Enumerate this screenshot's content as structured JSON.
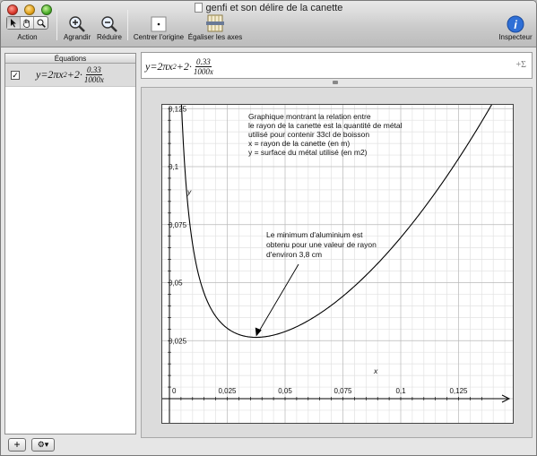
{
  "window": {
    "title": "genfi et son délire de la canette"
  },
  "toolbar": {
    "action_label": "Action",
    "zoom_in_label": "Agrandir",
    "zoom_out_label": "Réduire",
    "center_origin_label": "Centrer l'origine",
    "equalize_axes_label": "Égaliser les axes",
    "inspector_label": "Inspecteur"
  },
  "sidebar": {
    "header": "Équations",
    "equations": [
      {
        "checked": true,
        "lhs": "y=2πx",
        "exp": "2",
        "mid": "+2·",
        "num": "0.33",
        "den": "1000x"
      }
    ],
    "add_label": "+",
    "gear_label": "⚙▾"
  },
  "formula_bar": {
    "lhs": "y=2πx",
    "exp": "2",
    "mid": "+2·",
    "num": "0.33",
    "den": "1000x",
    "sigma": "+Σ"
  },
  "graph": {
    "x_label": "x",
    "y_label": "y",
    "x_ticks": [
      "0",
      "0,025",
      "0,05",
      "0,075",
      "0,1",
      "0,125"
    ],
    "y_ticks": [
      "0,025",
      "0,05",
      "0,075",
      "0,1",
      "0,125"
    ],
    "annotation_lines": [
      "Graphique montrant la relation entre",
      "le rayon de la canette est la quantité de métal",
      "utilisé pour contenir 33cl de boisson",
      "x = rayon de la canette (en m)",
      "y = surface du métal utilisé (en m2)"
    ],
    "minimum_lines": [
      "Le minimum d'aluminium est",
      "obtenu pour une valeur de rayon",
      "d'environ 3,8 cm"
    ]
  },
  "chart_data": {
    "type": "line",
    "title": "",
    "xlabel": "x",
    "ylabel": "y",
    "xlim": [
      0,
      0.14
    ],
    "ylim": [
      0,
      0.125
    ],
    "x_ticks": [
      0,
      0.025,
      0.05,
      0.075,
      0.1,
      0.125
    ],
    "y_ticks": [
      0.025,
      0.05,
      0.075,
      0.1,
      0.125
    ],
    "grid": true,
    "series": [
      {
        "expression": "y = 2πx² + 2·0.33/(1000x)",
        "x": [
          0.005,
          0.006,
          0.0075,
          0.01,
          0.0125,
          0.015,
          0.02,
          0.025,
          0.03,
          0.035,
          0.0375,
          0.04,
          0.045,
          0.05,
          0.06,
          0.07,
          0.08,
          0.09,
          0.1,
          0.11,
          0.12,
          0.13,
          0.14
        ],
        "y": [
          0.1322,
          0.1102,
          0.0884,
          0.0666,
          0.0538,
          0.0454,
          0.0355,
          0.0303,
          0.0277,
          0.0266,
          0.0265,
          0.0266,
          0.0274,
          0.0289,
          0.0336,
          0.0402,
          0.0485,
          0.0582,
          0.0694,
          0.082,
          0.096,
          0.1113,
          0.1279
        ]
      }
    ]
  }
}
